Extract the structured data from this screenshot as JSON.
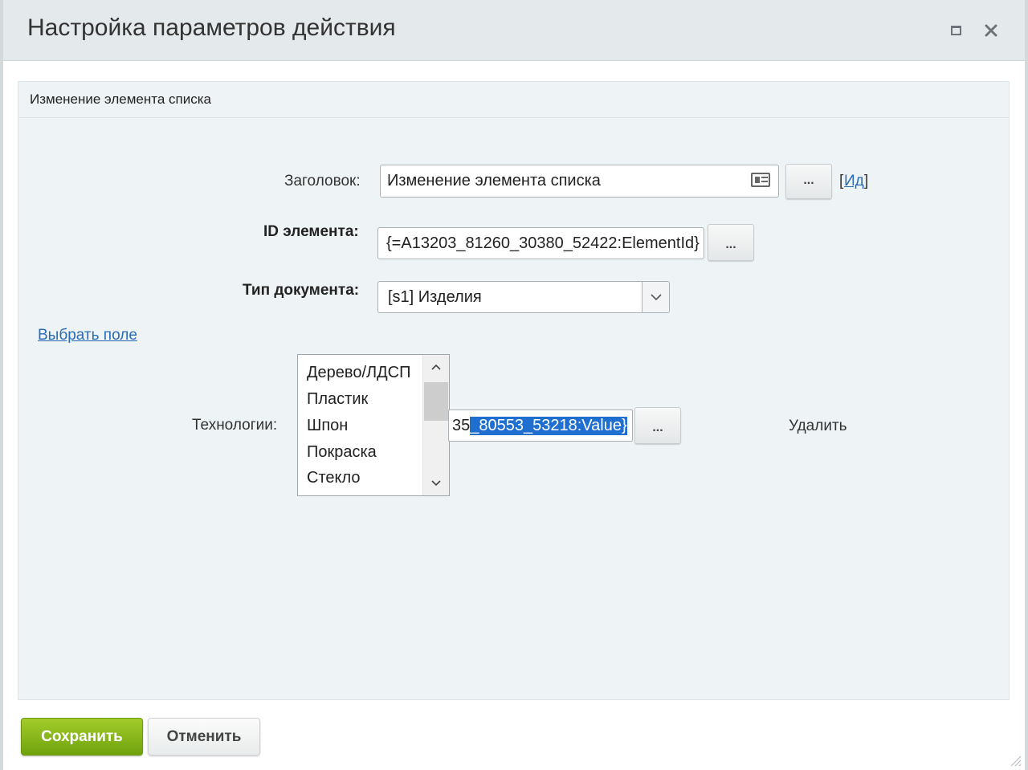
{
  "window": {
    "title": "Настройка параметров действия",
    "maximize_icon": "maximize-icon",
    "close_icon": "close-icon"
  },
  "panel": {
    "title": "Изменение элемента списка"
  },
  "form": {
    "title_label": "Заголовок:",
    "title_value": "Изменение элемента списка",
    "title_dots": "...",
    "id_link_open": "[",
    "id_link": "Ид",
    "id_link_close": "]",
    "element_id_label": "ID элемента:",
    "element_id_value": "{=A13203_81260_30380_52422:ElementId}",
    "element_id_dots": "...",
    "doc_type_label": "Тип документа:",
    "doc_type_value": "[s1] Изделия",
    "choose_field_link": "Выбрать поле",
    "tech_label": "Технологии:",
    "tech_options": [
      "Дерево/ЛДСП",
      "Пластик",
      "Шпон",
      "Покраска",
      "Стекло"
    ],
    "tech_value_prefix": "35",
    "tech_value_selected": "_80553_53218:Value}",
    "tech_dots": "...",
    "delete_label": "Удалить"
  },
  "footer": {
    "save_label": "Сохранить",
    "cancel_label": "Отменить"
  },
  "colors": {
    "save_button": "#8bb81c",
    "link": "#2a6bb8",
    "selection": "#1f6fd0",
    "titlebar": "#e4eaec",
    "panel_bg": "#eef3f5"
  }
}
